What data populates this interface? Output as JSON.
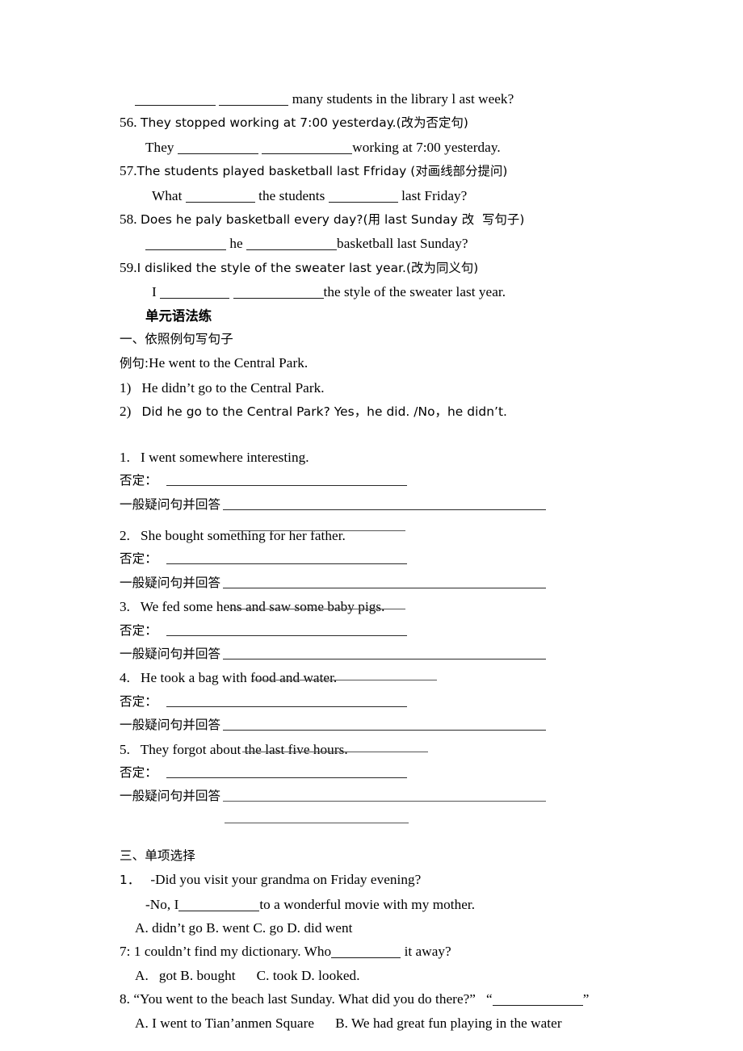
{
  "document": {
    "type": "english-grammar-worksheet",
    "language": "zh-CN/en"
  },
  "transform_section": {
    "carryover_line": {
      "tail": "many students in the library l ast week?"
    },
    "items": [
      {
        "number": "56.",
        "prompt": "They stopped working at 7:00 yesterday.(改为否定句)",
        "answer_prefix": "They",
        "answer_suffix": "working at 7:00 yesterday."
      },
      {
        "number": "57.",
        "prompt": "The students played basketball last Ffriday (对画线部分提问)",
        "answer_prefix": "What",
        "answer_middle": "the students",
        "answer_suffix": "last Friday?"
      },
      {
        "number": "58.",
        "prompt": "Does he paly basketball every day?(用 last Sunday 改  写句子)",
        "answer_prefix": "",
        "answer_middle": "he",
        "answer_suffix": "basketball last Sunday?"
      },
      {
        "number": "59.",
        "prompt": "I disliked the style of the sweater last year.(改为同义句)",
        "answer_prefix": "I",
        "answer_suffix": "the style of the sweater last year."
      }
    ]
  },
  "grammar_section": {
    "heading": "单元语法练",
    "part_one_heading": "一、依照例句写句子",
    "example_label": "例句:",
    "example_sentence": "He went to the Central Park.",
    "example_answers": [
      {
        "marker": "1)",
        "text": "He didn’t go to the Central Park."
      },
      {
        "marker": "2)",
        "text": "Did he go to the Central Park? Yes，he did. /No，he didn’t."
      }
    ],
    "labels": {
      "negative": "否定：",
      "question": "一般疑问句并回答"
    },
    "exercises": [
      {
        "number": "1.",
        "sentence": "I went somewhere interesting."
      },
      {
        "number": "2.",
        "sentence": "She bought something for her father."
      },
      {
        "number": "3.",
        "sentence": "We fed some hens and saw some baby pigs."
      },
      {
        "number": "4.",
        "sentence": "He took a bag with food and water."
      },
      {
        "number": "5.",
        "sentence": "They forgot about the last five hours."
      }
    ]
  },
  "choice_section": {
    "heading": "三、单项选择",
    "items": [
      {
        "number": "1．",
        "line1": "-Did you visit your grandma on Friday evening?",
        "line2_prefix": "-No, I",
        "line2_suffix": "to a wonderful movie with my mother.",
        "options": "A. didn’t go B. went C. go D. did went"
      },
      {
        "number": "7:",
        "line1_prefix": "1 couldn’t find my dictionary. Who",
        "line1_suffix": "it away?",
        "options": "A.   got B. bought      C. took D. looked."
      },
      {
        "number": "8.",
        "line1_prefix": "“You went to the beach last Sunday. What did you do there?”   “",
        "line1_suffix": "”",
        "options": "A. I went to Tian’anmen Square      B. We had great fun playing in the water"
      }
    ]
  }
}
